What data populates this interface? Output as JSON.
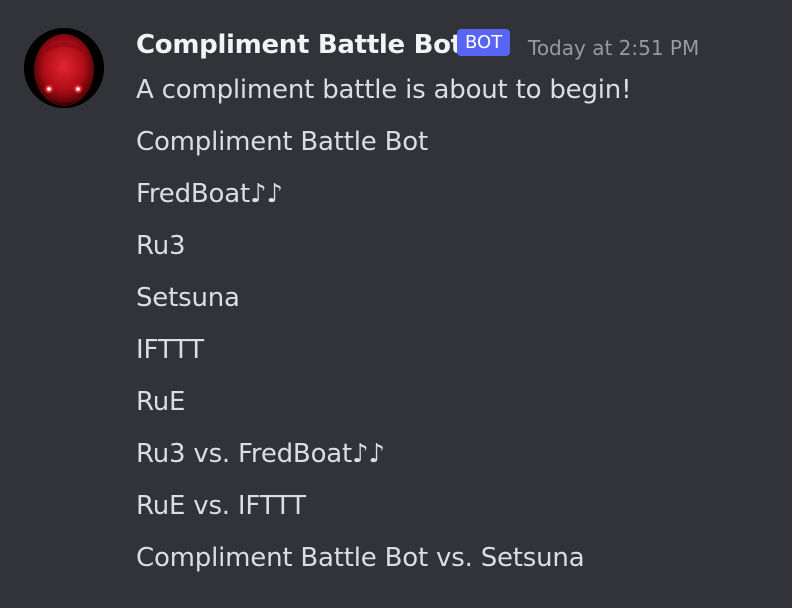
{
  "message": {
    "author": "Compliment Battle Bot",
    "bot_tag": "BOT",
    "timestamp": "Today at 2:51 PM",
    "lines": [
      "A compliment battle is about to begin!",
      "Compliment Battle Bot",
      "FredBoat♪♪",
      "Ru3",
      "Setsuna",
      "IFTTT",
      "RuE",
      "Ru3 vs. FredBoat♪♪",
      "RuE vs. IFTTT",
      "Compliment Battle Bot vs. Setsuna"
    ]
  },
  "colors": {
    "background": "#313338",
    "username": "#f2f3f5",
    "bot_tag_bg": "#5865f2",
    "timestamp": "#949ba4",
    "text": "#dbdee1",
    "avatar_face": "#c8101e",
    "avatar_eyes": "#ff3b3b"
  },
  "icons": {
    "avatar": "red-robot-face-avatar"
  }
}
